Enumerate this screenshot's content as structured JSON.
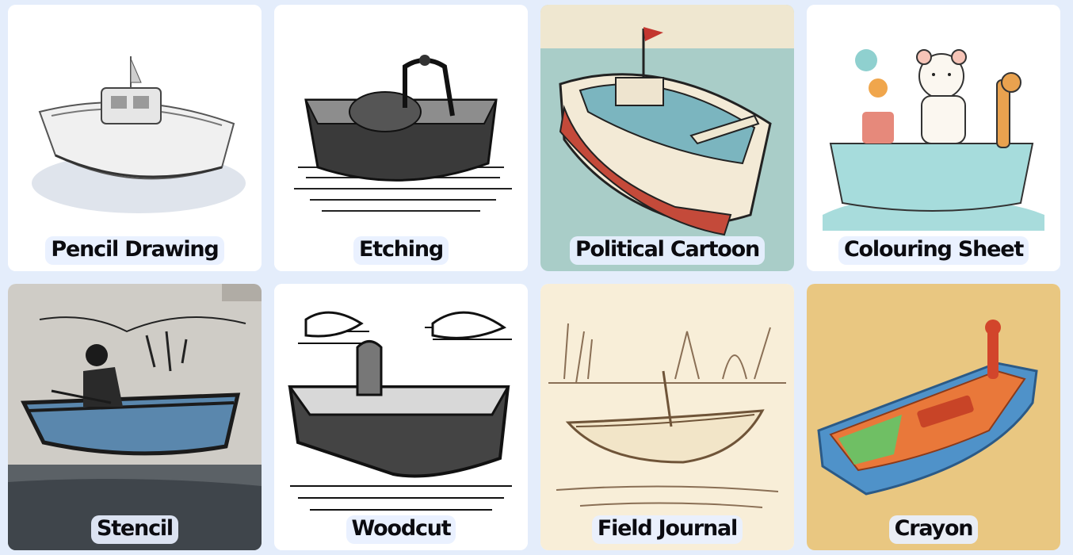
{
  "styles": [
    {
      "id": "pencil-drawing",
      "label": "Pencil Drawing",
      "bg": "#ffffff"
    },
    {
      "id": "etching",
      "label": "Etching",
      "bg": "#ffffff"
    },
    {
      "id": "political-cartoon",
      "label": "Political Cartoon",
      "bg": "#a9cdc8"
    },
    {
      "id": "colouring-sheet",
      "label": "Colouring Sheet",
      "bg": "#ffffff"
    },
    {
      "id": "stencil",
      "label": "Stencil",
      "bg": "#c9c6c0"
    },
    {
      "id": "woodcut",
      "label": "Woodcut",
      "bg": "#ffffff"
    },
    {
      "id": "field-journal",
      "label": "Field Journal",
      "bg": "#f8eed8"
    },
    {
      "id": "crayon",
      "label": "Crayon",
      "bg": "#e9c781"
    }
  ],
  "theme": {
    "page_bg": "#e4edfb",
    "label_bg": "#e8f0ff",
    "label_color": "#0b0b10"
  }
}
